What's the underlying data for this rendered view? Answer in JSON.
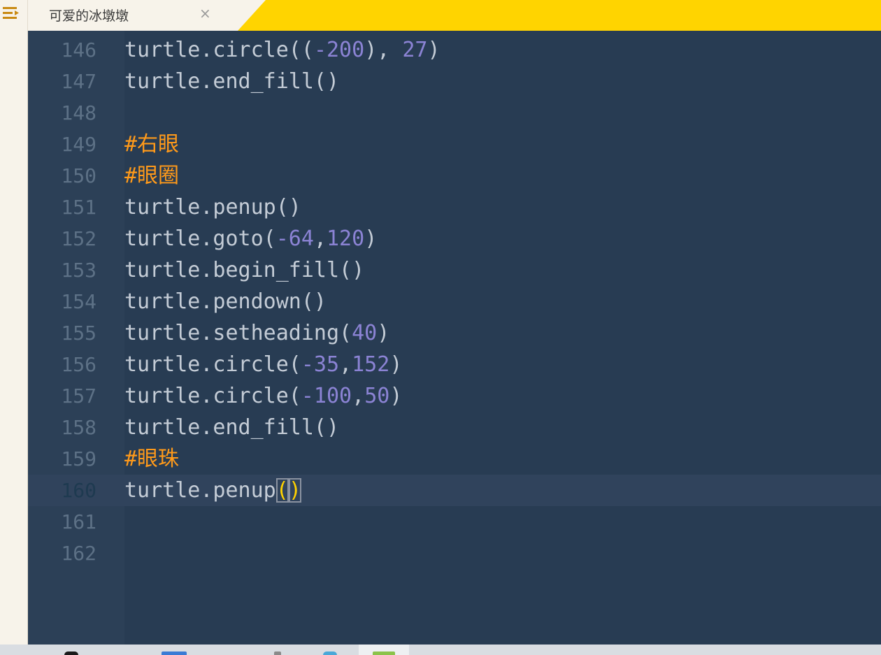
{
  "tab": {
    "title": "可爱的冰墩墩",
    "close_label": "×"
  },
  "editor": {
    "current_line": 160,
    "lines": [
      {
        "n": "146",
        "tokens": [
          {
            "t": "turtle.circle(("
          },
          {
            "t": "-200",
            "c": "num"
          },
          {
            "t": "), "
          },
          {
            "t": "27",
            "c": "num"
          },
          {
            "t": ")"
          }
        ]
      },
      {
        "n": "147",
        "tokens": [
          {
            "t": "turtle.end_fill()"
          }
        ]
      },
      {
        "n": "148",
        "tokens": []
      },
      {
        "n": "149",
        "tokens": [
          {
            "t": "#右眼",
            "c": "cm"
          }
        ]
      },
      {
        "n": "150",
        "tokens": [
          {
            "t": "#眼圈",
            "c": "cm"
          }
        ]
      },
      {
        "n": "151",
        "tokens": [
          {
            "t": "turtle.penup()"
          }
        ]
      },
      {
        "n": "152",
        "tokens": [
          {
            "t": "turtle.goto("
          },
          {
            "t": "-64",
            "c": "num"
          },
          {
            "t": ","
          },
          {
            "t": "120",
            "c": "num"
          },
          {
            "t": ")"
          }
        ]
      },
      {
        "n": "153",
        "tokens": [
          {
            "t": "turtle.begin_fill()"
          }
        ]
      },
      {
        "n": "154",
        "tokens": [
          {
            "t": "turtle.pendown()"
          }
        ]
      },
      {
        "n": "155",
        "tokens": [
          {
            "t": "turtle.setheading("
          },
          {
            "t": "40",
            "c": "num"
          },
          {
            "t": ")"
          }
        ]
      },
      {
        "n": "156",
        "tokens": [
          {
            "t": "turtle.circle("
          },
          {
            "t": "-35",
            "c": "num"
          },
          {
            "t": ","
          },
          {
            "t": "152",
            "c": "num"
          },
          {
            "t": ")"
          }
        ]
      },
      {
        "n": "157",
        "tokens": [
          {
            "t": "turtle.circle("
          },
          {
            "t": "-100",
            "c": "num"
          },
          {
            "t": ","
          },
          {
            "t": "50",
            "c": "num"
          },
          {
            "t": ")"
          }
        ]
      },
      {
        "n": "158",
        "tokens": [
          {
            "t": "turtle.end_fill()"
          }
        ]
      },
      {
        "n": "159",
        "tokens": [
          {
            "t": "#眼珠",
            "c": "cm"
          }
        ]
      },
      {
        "n": "160",
        "tokens": [
          {
            "t": "turtle.penup"
          },
          {
            "t": "(",
            "c": "br"
          },
          {
            "t": ")",
            "c": "br"
          }
        ]
      },
      {
        "n": "161",
        "tokens": []
      },
      {
        "n": "162",
        "tokens": []
      }
    ]
  },
  "colors": {
    "tabbar_accent": "#ffd400",
    "editor_bg": "#283c53",
    "gutter_bg": "#2c4057",
    "number_token": "#8b83d4",
    "comment_token": "#ff9a1a",
    "bracket_match": "#ffd200"
  },
  "icons": {
    "sidebar_menu": "menu-icon",
    "tab_close": "close-icon"
  }
}
